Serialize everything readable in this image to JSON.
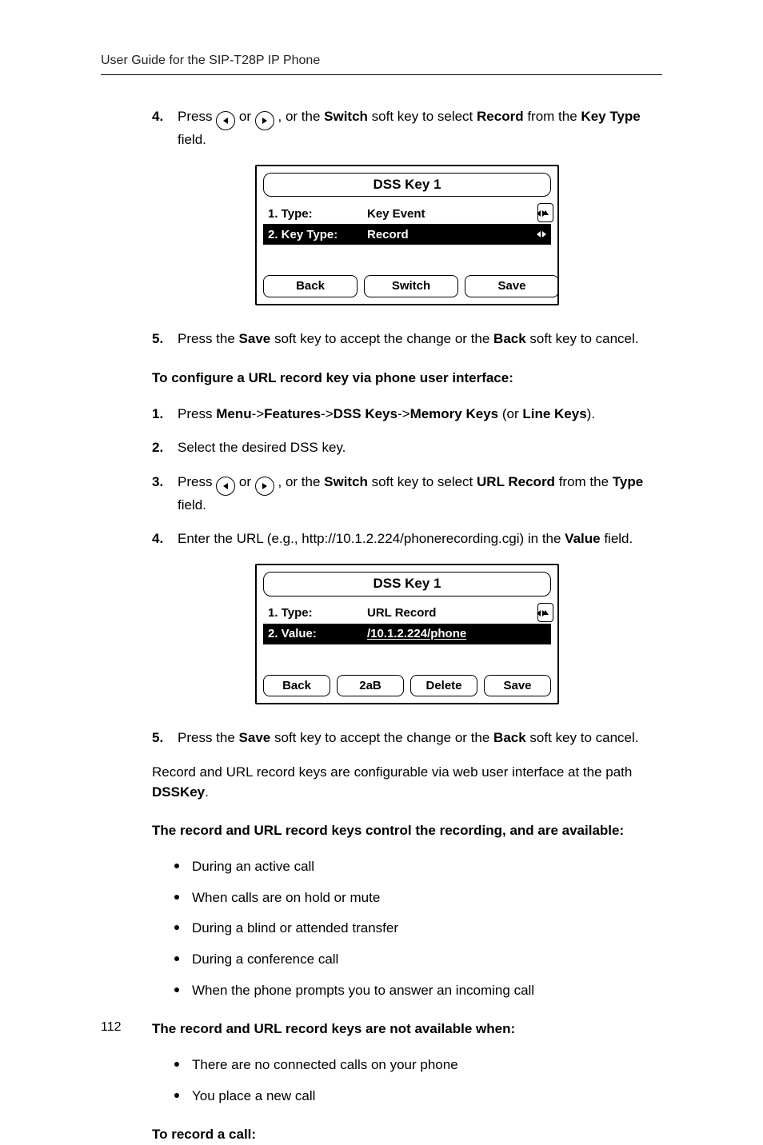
{
  "header": {
    "running": "User Guide for the SIP-T28P IP Phone"
  },
  "page_number": "112",
  "step4a": {
    "num": "4.",
    "press": "Press ",
    "or": " or ",
    "or_the": " , or the ",
    "switch": "Switch",
    "soft_key_to_select": " soft key to select ",
    "record": "Record",
    "from_the": " from the ",
    "key_type": "Key Type",
    "field": " field."
  },
  "lcd1": {
    "title": "DSS Key 1",
    "row1": {
      "label": "1. Type:",
      "value": "Key Event"
    },
    "row2": {
      "label": "2. Key Type:",
      "value": "Record"
    },
    "soft": {
      "back": "Back",
      "switch": "Switch",
      "save": "Save"
    }
  },
  "step5a": {
    "num": "5.",
    "t1": "Press the ",
    "save": "Save",
    "t2": " soft key to accept the change or the ",
    "back": "Back",
    "t3": " soft key to cancel."
  },
  "title1": "To configure a URL record key via phone user interface:",
  "step1": {
    "num": "1.",
    "t1": "Press ",
    "menu": "Menu",
    "a1": "->",
    "features": "Features",
    "a2": "->",
    "dsskeys": "DSS Keys",
    "a3": "->",
    "memkeys": "Memory Keys",
    "or": " (or ",
    "linekeys": "Line Keys",
    "close": ")."
  },
  "step2": {
    "num": "2.",
    "t": "Select the desired DSS key."
  },
  "step3": {
    "num": "3.",
    "press": "Press ",
    "or": " or ",
    "or_the": " , or the ",
    "switch": "Switch",
    "soft_key_to_select": " soft key to select ",
    "url_record": "URL Record",
    "from_the": " from the ",
    "type": "Type",
    "field": " field."
  },
  "step4b": {
    "num": "4.",
    "t1": "Enter the URL (e.g., http://10.1.2.224/phonerecording.cgi) in the ",
    "value": "Value",
    "t2": " field."
  },
  "lcd2": {
    "title": "DSS Key 1",
    "row1": {
      "label": "1. Type:",
      "value": "URL Record"
    },
    "row2": {
      "label": "2. Value:",
      "value": "/10.1.2.224/phone"
    },
    "soft": {
      "back": "Back",
      "mode": "2aB",
      "delete": "Delete",
      "save": "Save"
    }
  },
  "step5b": {
    "num": "5.",
    "t1": "Press the ",
    "save": "Save",
    "t2": " soft key to accept the change or the ",
    "back": "Back",
    "t3": " soft key to cancel."
  },
  "para1a": "Record and URL record keys are configurable via web user interface at the path ",
  "para1b": "DSSKey",
  "para1c": ".",
  "title2": "The record and URL record keys control the recording, and are available:",
  "avail": [
    "During an active call",
    "When calls are on hold or mute",
    "During a blind or attended transfer",
    "During a conference call",
    "When the phone prompts you to answer an incoming call"
  ],
  "title3": "The record and URL record keys are not available when:",
  "notavail": [
    "There are no connected calls on your phone",
    "You place a new call"
  ],
  "title4": "To record a call:"
}
